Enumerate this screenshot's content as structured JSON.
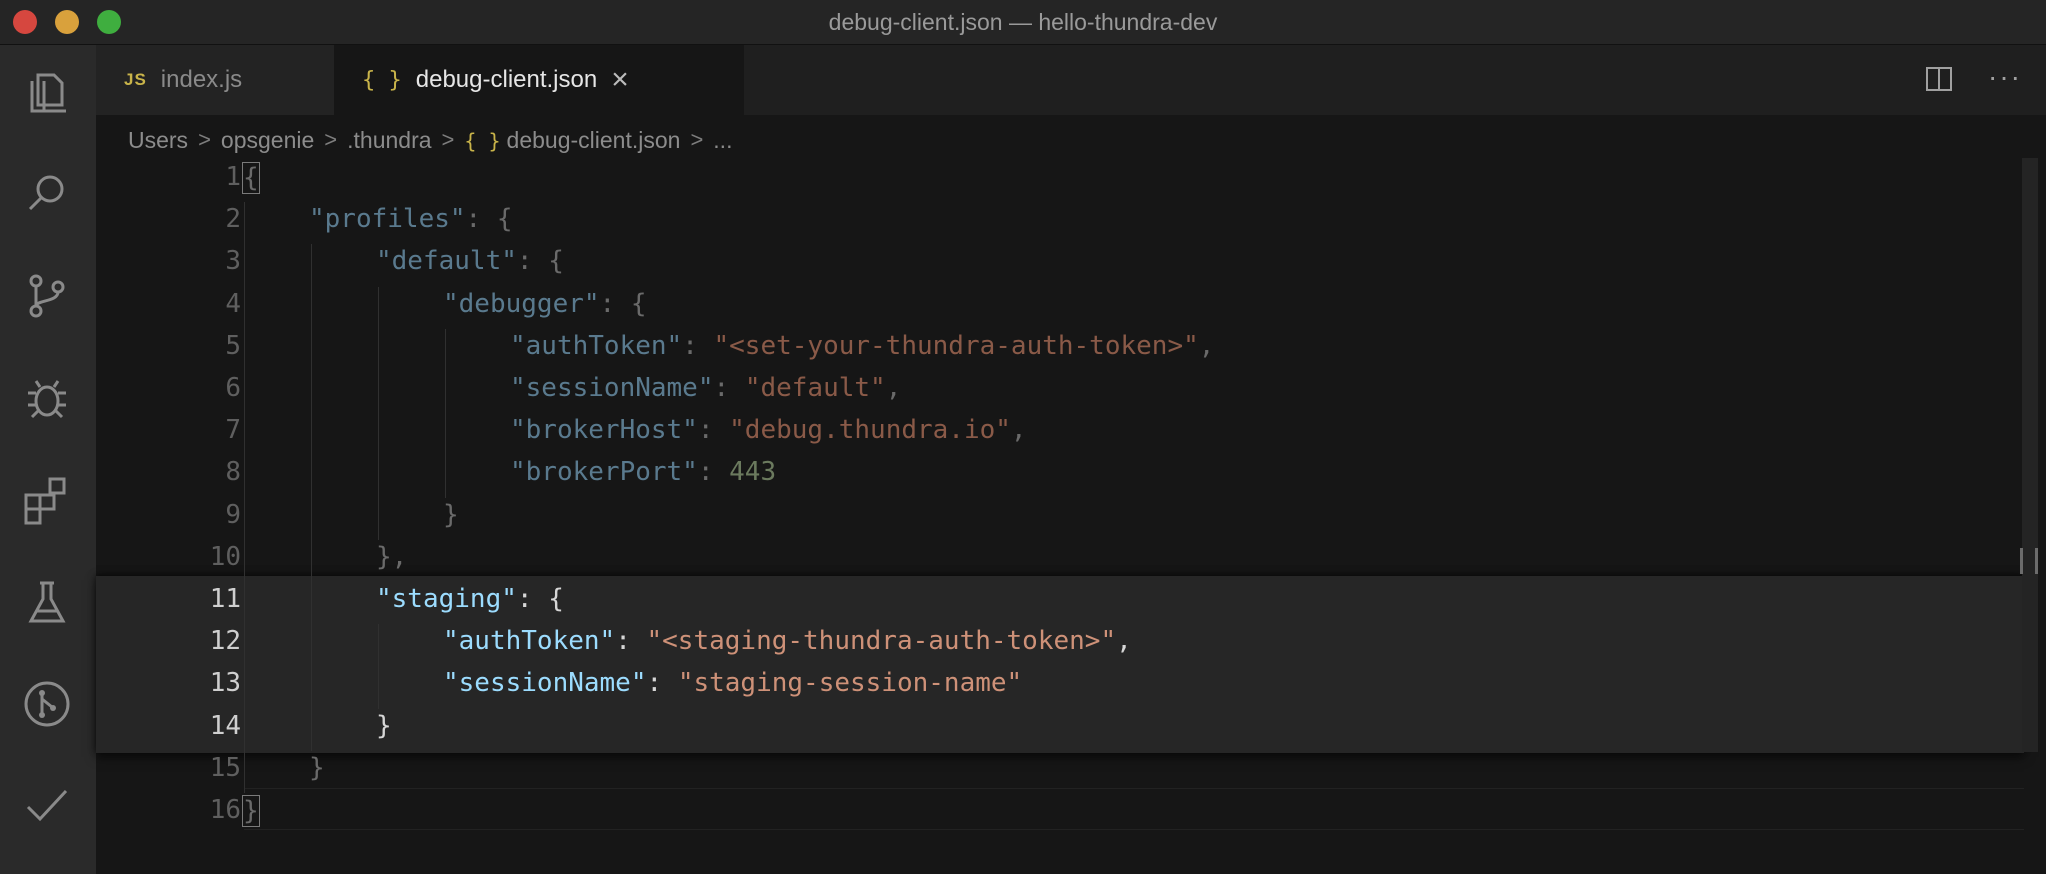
{
  "window": {
    "title": "debug-client.json — hello-thundra-dev"
  },
  "activity_bar": {
    "icons": [
      "explorer-icon",
      "search-icon",
      "source-control-icon",
      "debug-icon",
      "extensions-icon",
      "testing-icon",
      "git-graph-icon",
      "checkmark-icon"
    ]
  },
  "tabs": [
    {
      "icon": "JS",
      "label": "index.js",
      "active": false
    },
    {
      "icon": "{ }",
      "label": "debug-client.json",
      "active": true,
      "close": "×"
    }
  ],
  "breadcrumb": {
    "items": [
      "Users",
      "opsgenie",
      ".thundra",
      "debug-client.json",
      "..."
    ],
    "json_icon": "{ }",
    "separator": ">"
  },
  "editor": {
    "lines": [
      {
        "n": "1",
        "text": "{"
      },
      {
        "n": "2",
        "text": "\"profiles\": {"
      },
      {
        "n": "3",
        "text": "\"default\": {"
      },
      {
        "n": "4",
        "text": "\"debugger\": {"
      },
      {
        "n": "5",
        "text": "\"authToken\": \"<set-your-thundra-auth-token>\","
      },
      {
        "n": "6",
        "text": "\"sessionName\": \"default\","
      },
      {
        "n": "7",
        "text": "\"brokerHost\": \"debug.thundra.io\","
      },
      {
        "n": "8",
        "text": "\"brokerPort\": 443"
      },
      {
        "n": "9",
        "text": "}"
      },
      {
        "n": "10",
        "text": "},"
      },
      {
        "n": "11",
        "text": "\"staging\": {"
      },
      {
        "n": "12",
        "text": "\"authToken\": \"<staging-thundra-auth-token>\","
      },
      {
        "n": "13",
        "text": "\"sessionName\": \"staging-session-name\""
      },
      {
        "n": "14",
        "text": "}"
      },
      {
        "n": "15",
        "text": "}"
      },
      {
        "n": "16",
        "text": "}"
      }
    ],
    "colors": {
      "key": "#9cdcfe",
      "string": "#ce9178",
      "number": "#b5cea8"
    }
  }
}
